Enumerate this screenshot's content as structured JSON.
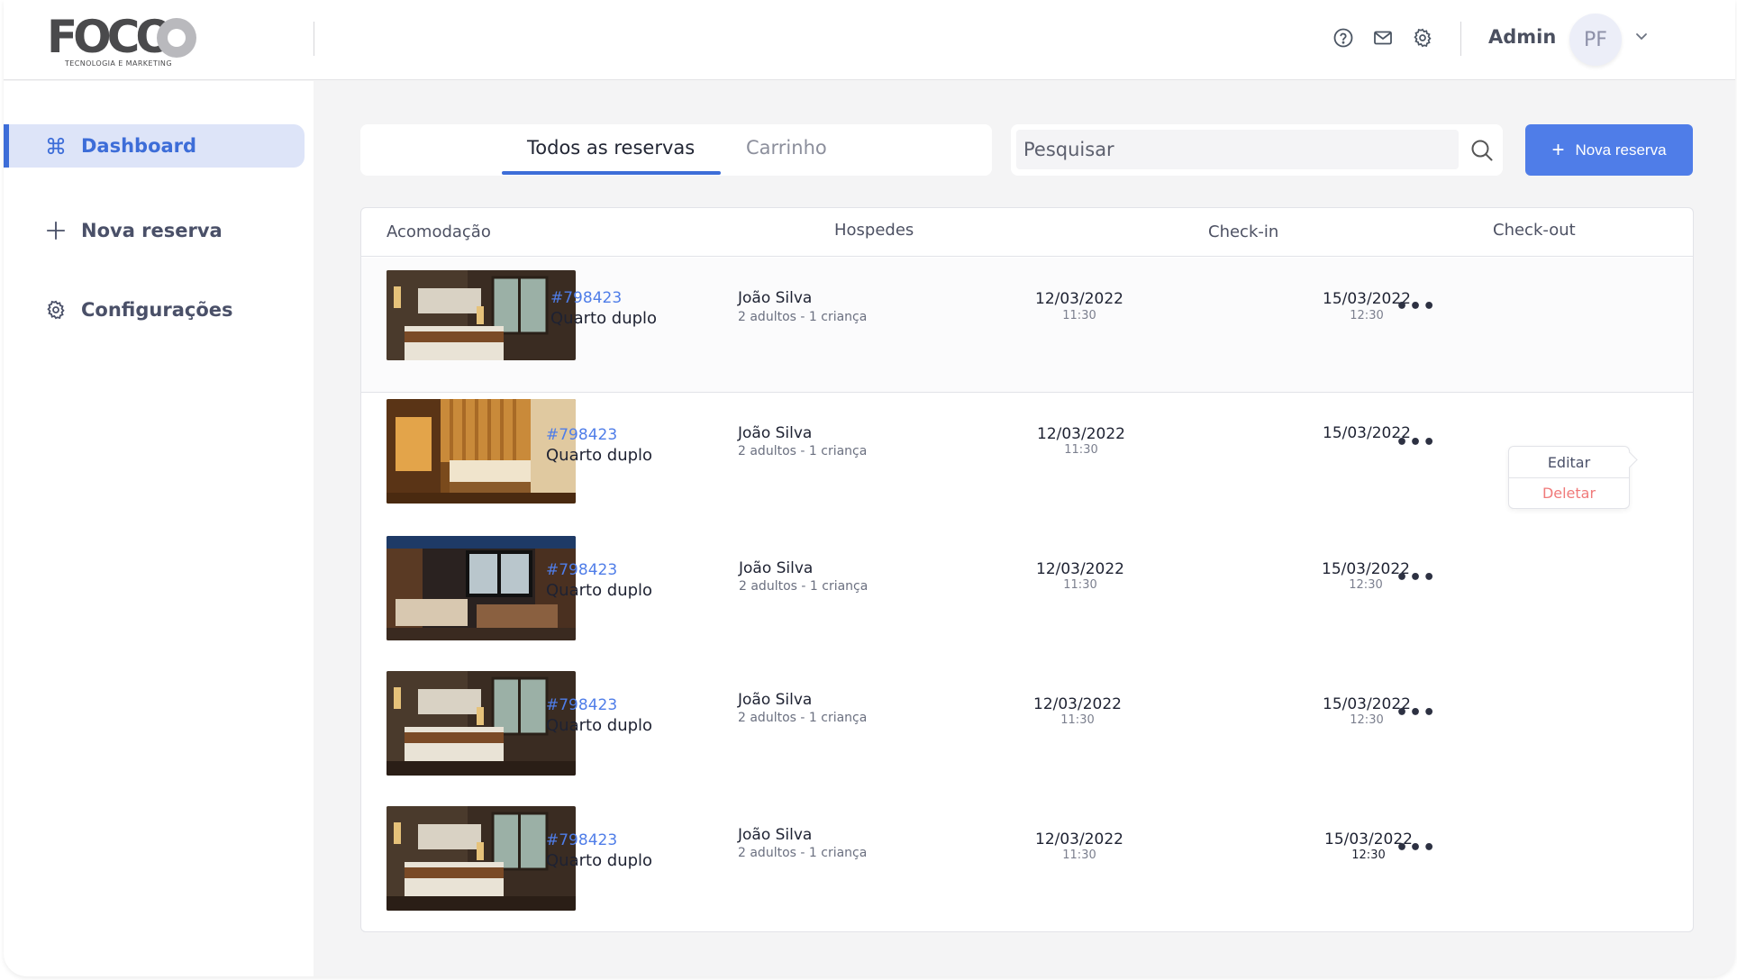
{
  "header": {
    "logo_text": "FOCO",
    "logo_tagline": "TECNOLOGIA E MARKETING",
    "icons": [
      "help-circle-icon",
      "mail-icon",
      "settings-icon"
    ],
    "user_name": "Admin",
    "avatar_initials": "PF"
  },
  "sidebar": {
    "items": [
      {
        "label": "Dashboard",
        "icon": "command-icon",
        "active": true
      },
      {
        "label": "Nova reserva",
        "icon": "plus-icon",
        "active": false
      },
      {
        "label": "Configurações",
        "icon": "gear-icon",
        "active": false
      }
    ]
  },
  "toolbar": {
    "tabs": [
      {
        "label": "Todos as reservas",
        "active": true
      },
      {
        "label": "Carrinho",
        "active": false
      }
    ],
    "search_placeholder": "Pesquisar",
    "new_button_label": "Nova reserva"
  },
  "table": {
    "columns": [
      "Acomodação",
      "Hospedes",
      "Check-in",
      "Check-out"
    ],
    "rows": [
      {
        "code": "#798423",
        "room": "Quarto duplo",
        "guest": "João Silva",
        "guest_detail": "2 adultos - 1 criança",
        "checkin_date": "12/03/2022",
        "checkin_time": "11:30",
        "checkout_date": "15/03/2022",
        "checkout_time": "12:30"
      },
      {
        "code": "#798423",
        "room": "Quarto duplo",
        "guest": "João Silva",
        "guest_detail": "2 adultos - 1 criança",
        "checkin_date": "12/03/2022",
        "checkin_time": "11:30",
        "checkout_date": "15/03/2022",
        "checkout_time": "12:30"
      },
      {
        "code": "#798423",
        "room": "Quarto duplo",
        "guest": "João Silva",
        "guest_detail": "2 adultos - 1 criança",
        "checkin_date": "12/03/2022",
        "checkin_time": "11:30",
        "checkout_date": "15/03/2022",
        "checkout_time": "12:30"
      },
      {
        "code": "#798423",
        "room": "Quarto duplo",
        "guest": "João Silva",
        "guest_detail": "2 adultos - 1 criança",
        "checkin_date": "12/03/2022",
        "checkin_time": "11:30",
        "checkout_date": "15/03/2022",
        "checkout_time": "12:30"
      },
      {
        "code": "#798423",
        "room": "Quarto duplo",
        "guest": "João Silva",
        "guest_detail": "2 adultos - 1 criança",
        "checkin_date": "12/03/2022",
        "checkin_time": "11:30",
        "checkout_date": "15/03/2022",
        "checkout_time": "12:30"
      }
    ],
    "row_menu": {
      "edit_label": "Editar",
      "delete_label": "Deletar"
    }
  },
  "colors": {
    "accent": "#3d6dd8",
    "button": "#4f7de8",
    "danger": "#f07a7a"
  }
}
